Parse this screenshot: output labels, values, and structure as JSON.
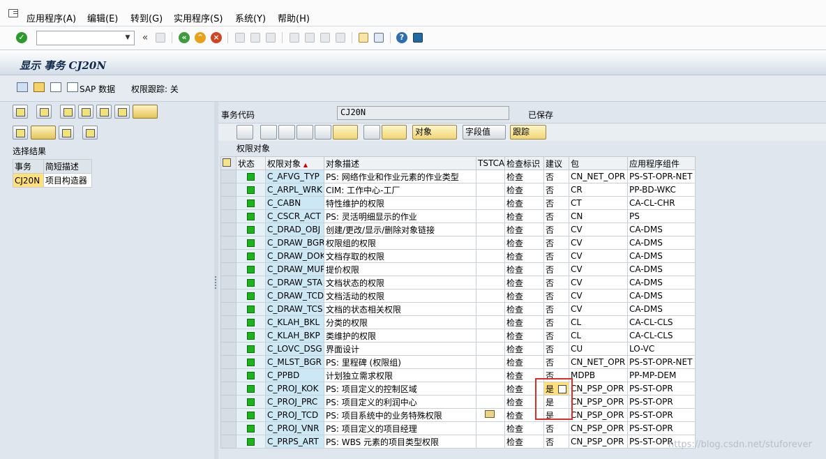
{
  "menu": {
    "items": [
      "应用程序(A)",
      "编辑(E)",
      "转到(G)",
      "实用程序(S)",
      "系统(Y)",
      "帮助(H)"
    ]
  },
  "toolbar": {
    "nav_back": "«"
  },
  "title": "显示 事务 CJ20N",
  "app_toolbar": {
    "sap_data": "SAP 数据",
    "trace": "权限跟踪: 关"
  },
  "left": {
    "result_label": "选择结果",
    "columns": [
      "事务",
      "简短描述"
    ],
    "rows": [
      [
        "CJ20N",
        "项目构造器"
      ]
    ]
  },
  "right": {
    "tcode_label": "事务代码",
    "tcode_value": "CJ20N",
    "saved": "已保存",
    "grid_buttons": {
      "object": "对象",
      "field_value": "字段值",
      "trace": "跟踪"
    },
    "grid_title": "权限对象",
    "columns": [
      "状态",
      "权限对象",
      "对象描述",
      "TSTCA",
      "检查标识",
      "建议",
      "包",
      "应用程序组件"
    ],
    "rows": [
      [
        "C_AFVG_TYP",
        "PS: 网络作业和作业元素的作业类型",
        "",
        "检查",
        "否",
        "CN_NET_OPR",
        "PS-ST-OPR-NET"
      ],
      [
        "C_ARPL_WRK",
        "CIM: 工作中心-工厂",
        "",
        "检查",
        "否",
        "CR",
        "PP-BD-WKC"
      ],
      [
        "C_CABN",
        "特性维护的权限",
        "",
        "检查",
        "否",
        "CT",
        "CA-CL-CHR"
      ],
      [
        "C_CSCR_ACT",
        "PS: 灵活明细显示的作业",
        "",
        "检查",
        "否",
        "CN",
        "PS"
      ],
      [
        "C_DRAD_OBJ",
        "创建/更改/显示/删除对象链接",
        "",
        "检查",
        "否",
        "CV",
        "CA-DMS"
      ],
      [
        "C_DRAW_BGR",
        "权限组的权限",
        "",
        "检查",
        "否",
        "CV",
        "CA-DMS"
      ],
      [
        "C_DRAW_DOK",
        "文档存取的权限",
        "",
        "检查",
        "否",
        "CV",
        "CA-DMS"
      ],
      [
        "C_DRAW_MUP",
        "提价权限",
        "",
        "检查",
        "否",
        "CV",
        "CA-DMS"
      ],
      [
        "C_DRAW_STA",
        "文档状态的权限",
        "",
        "检查",
        "否",
        "CV",
        "CA-DMS"
      ],
      [
        "C_DRAW_TCD",
        "文档活动的权限",
        "",
        "检查",
        "否",
        "CV",
        "CA-DMS"
      ],
      [
        "C_DRAW_TCS",
        "文档的状态相关权限",
        "",
        "检查",
        "否",
        "CV",
        "CA-DMS"
      ],
      [
        "C_KLAH_BKL",
        "分类的权限",
        "",
        "检查",
        "否",
        "CL",
        "CA-CL-CLS"
      ],
      [
        "C_KLAH_BKP",
        "类维护的权限",
        "",
        "检查",
        "否",
        "CL",
        "CA-CL-CLS"
      ],
      [
        "C_LOVC_DSG",
        "界面设计",
        "",
        "检查",
        "否",
        "CU",
        "LO-VC"
      ],
      [
        "C_MLST_BGR",
        "PS: 里程碑 (权限组)",
        "",
        "检查",
        "否",
        "CN_NET_OPR",
        "PS-ST-OPR-NET"
      ],
      [
        "C_PPBD",
        "计划独立需求权限",
        "",
        "检查",
        "否",
        "MDPB",
        "PP-MP-DEM"
      ],
      [
        "C_PROJ_KOK",
        "PS: 项目定义的控制区域",
        "",
        "检查",
        "是",
        "CN_PSP_OPR",
        "PS-ST-OPR"
      ],
      [
        "C_PROJ_PRC",
        "PS: 项目定义的利润中心",
        "",
        "检查",
        "是",
        "CN_PSP_OPR",
        "PS-ST-OPR"
      ],
      [
        "C_PROJ_TCD",
        "PS: 项目系统中的业务特殊权限",
        "",
        "检查",
        "是",
        "CN_PSP_OPR",
        "PS-ST-OPR"
      ],
      [
        "C_PROJ_VNR",
        "PS: 项目定义的项目经理",
        "",
        "检查",
        "否",
        "CN_PSP_OPR",
        "PS-ST-OPR"
      ],
      [
        "C_PRPS_ART",
        "PS: WBS 元素的项目类型权限",
        "",
        "检查",
        "否",
        "CN_PSP_OPR",
        "PS-ST-OPR"
      ]
    ]
  },
  "watermark": "https://blog.csdn.net/stuforever",
  "colors": {
    "status_green": "#1bb51b",
    "highlight_yellow": "#ffe07a",
    "annotation_red": "#e12b2b"
  }
}
